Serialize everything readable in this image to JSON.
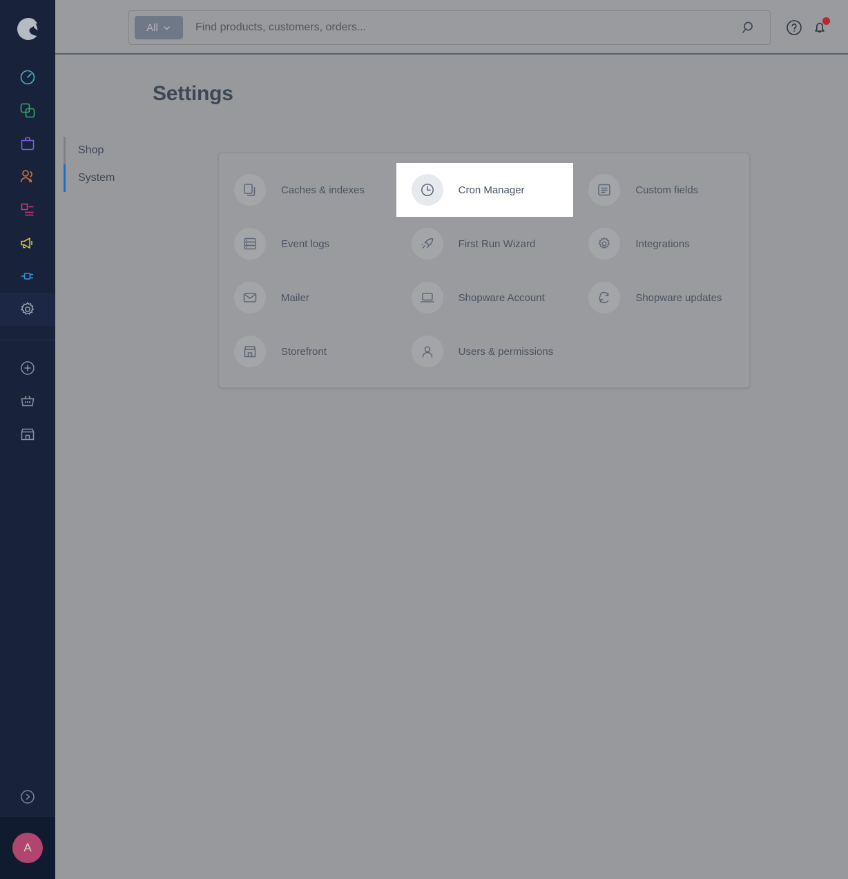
{
  "brand": {
    "logo_icon": "shopware-logo-icon",
    "accent": "#1a6fc4",
    "avatar_color": "#b0456f"
  },
  "header": {
    "scope_filter": {
      "label": "All",
      "icon": "chevron-down-icon"
    },
    "search": {
      "placeholder": "Find products, customers, orders...",
      "value": "",
      "icon": "search-icon"
    },
    "help_icon": "help-circle-icon",
    "notifications_icon": "bell-icon",
    "notifications_has_alert": true,
    "notification_dot_color": "#b52a2a"
  },
  "sidebar": {
    "items": [
      {
        "name": "dashboard",
        "icon": "dashboard-gauge-icon",
        "color": "#4cb1c4",
        "active": false
      },
      {
        "name": "catalogues",
        "icon": "catalogue-squares-icon",
        "color": "#37a866",
        "active": false
      },
      {
        "name": "orders",
        "icon": "orders-bag-icon",
        "color": "#7a5fd4",
        "active": false
      },
      {
        "name": "customers",
        "icon": "customers-people-icon",
        "color": "#d4763a",
        "active": false
      },
      {
        "name": "content",
        "icon": "content-document-icon",
        "color": "#d4387a",
        "active": false
      },
      {
        "name": "marketing",
        "icon": "marketing-megaphone-icon",
        "color": "#d7c033",
        "active": false
      },
      {
        "name": "extensions",
        "icon": "extensions-plug-icon",
        "color": "#2d9ae0",
        "active": false
      },
      {
        "name": "settings",
        "icon": "gear-icon",
        "color": "#9aa1ad",
        "active": true
      }
    ],
    "sub_items": [
      {
        "name": "add-new",
        "icon": "plus-circle-icon",
        "color": "#8a919e"
      },
      {
        "name": "basket",
        "icon": "basket-icon",
        "color": "#8a919e"
      },
      {
        "name": "storefront",
        "icon": "storefront-icon",
        "color": "#8a919e"
      }
    ],
    "expand": {
      "name": "expand-sidebar",
      "icon": "chevron-right-circle-icon"
    },
    "user": {
      "initial": "A"
    }
  },
  "main": {
    "title": "Settings",
    "tabs": [
      {
        "label": "Shop",
        "active": false
      },
      {
        "label": "System",
        "active": true
      }
    ],
    "tiles": [
      {
        "label": "Caches & indexes",
        "icon": "copy-documents-icon",
        "highlight": false
      },
      {
        "label": "Cron Manager",
        "icon": "clock-icon",
        "highlight": true
      },
      {
        "label": "Custom fields",
        "icon": "list-box-icon",
        "highlight": false
      },
      {
        "label": "Event logs",
        "icon": "database-icon",
        "highlight": false
      },
      {
        "label": "First Run Wizard",
        "icon": "rocket-icon",
        "highlight": false
      },
      {
        "label": "Integrations",
        "icon": "gear-icon",
        "highlight": false
      },
      {
        "label": "Mailer",
        "icon": "envelope-icon",
        "highlight": false
      },
      {
        "label": "Shopware Account",
        "icon": "laptop-icon",
        "highlight": false
      },
      {
        "label": "Shopware updates",
        "icon": "refresh-sync-icon",
        "highlight": false
      },
      {
        "label": "Storefront",
        "icon": "storefront-icon",
        "highlight": false
      },
      {
        "label": "Users & permissions",
        "icon": "user-icon",
        "highlight": false
      }
    ]
  }
}
